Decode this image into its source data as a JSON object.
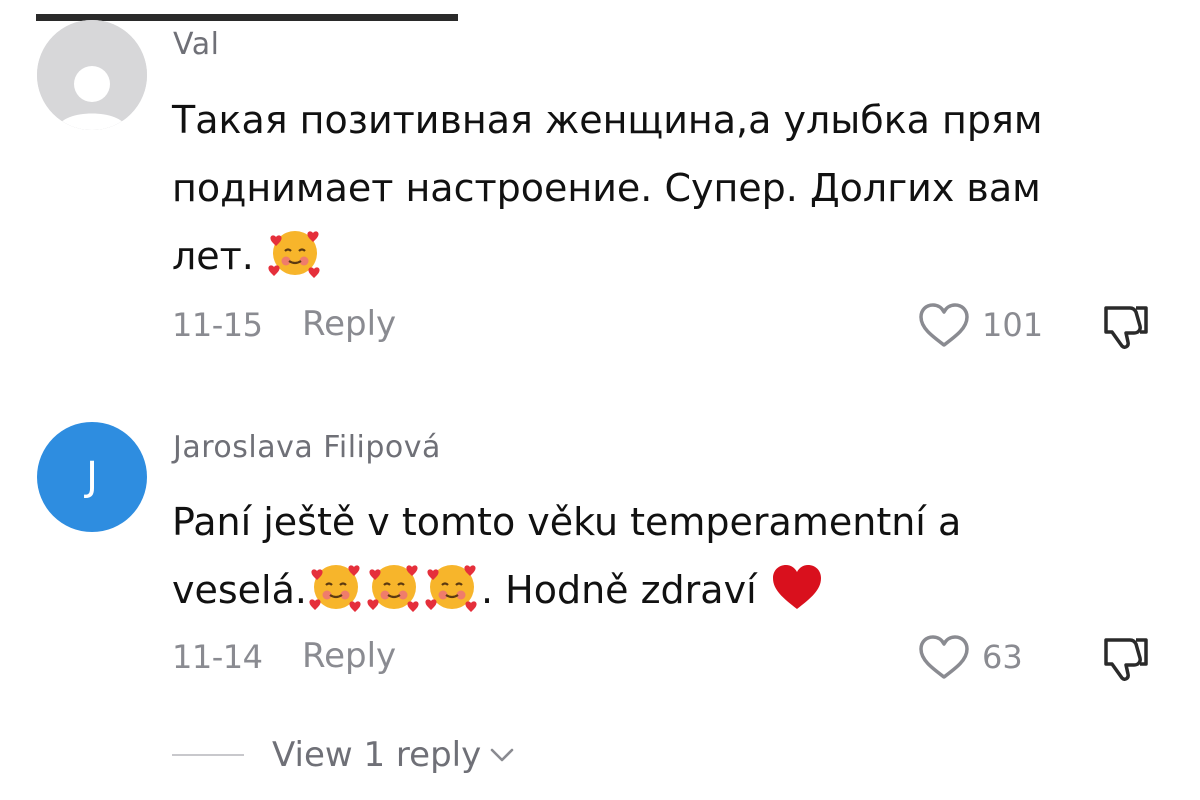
{
  "comments": [
    {
      "username": "Val",
      "avatar_type": "default-avatar",
      "text_lines": [
        "Такая позитивная женщина,а улыбка прям",
        "поднимает настроение. Супер. Долгих вам",
        "лет. "
      ],
      "emojis": [
        "smiling-face-with-hearts"
      ],
      "date": "11-15",
      "reply_label": "Reply",
      "likes": "101"
    },
    {
      "username": "Jaroslava Filipová",
      "avatar_letter": "J",
      "avatar_color": "#2e8de0",
      "text_lines": [
        "Paní ještě v tomto věku temperamentní a",
        "veselá.",
        ". Hodně zdraví "
      ],
      "emojis": [
        "smiling-face-with-hearts",
        "smiling-face-with-hearts",
        "smiling-face-with-hearts",
        "red-heart"
      ],
      "date": "11-14",
      "reply_label": "Reply",
      "likes": "63"
    }
  ],
  "view_replies": {
    "label": "View 1 reply",
    "icon": "chevron-down-icon"
  },
  "icons": {
    "like": "heart-outline-icon",
    "dislike": "thumbs-down-icon"
  }
}
